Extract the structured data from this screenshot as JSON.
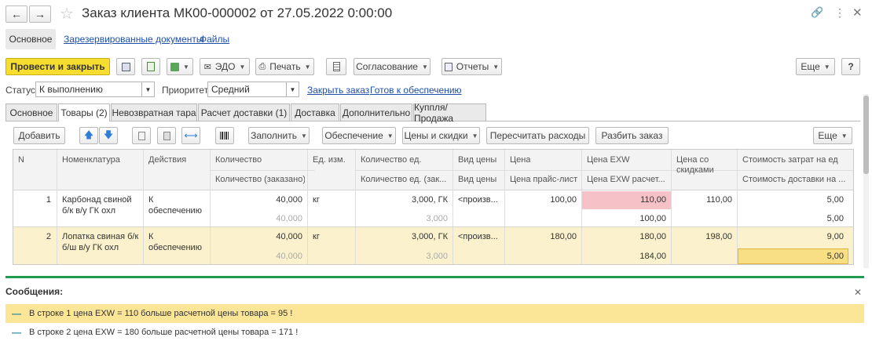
{
  "window": {
    "title": "Заказ клиента МК00-000002 от 27.05.2022 0:00:00"
  },
  "topnav": {
    "main": "Основное",
    "reserved_docs": "Зарезервированные документы",
    "files": "Файлы"
  },
  "toolbar": {
    "post_close": "Провести и закрыть",
    "edo": "ЭДО",
    "print": "Печать",
    "approval": "Согласование",
    "reports": "Отчеты",
    "more": "Еще",
    "help": "?"
  },
  "status_row": {
    "status_label": "Статус:",
    "status_value": "К выполнению",
    "priority_label": "Приоритет:",
    "priority_value": "Средний",
    "close_order": "Закрыть заказ",
    "ready_supply": "Готов к обеспечению"
  },
  "tabs": [
    {
      "label": "Основное"
    },
    {
      "label": "Товары (2)"
    },
    {
      "label": "Невозвратная тара"
    },
    {
      "label": "Расчет доставки (1)"
    },
    {
      "label": "Доставка"
    },
    {
      "label": "Дополнительно"
    },
    {
      "label": "Куппля/Продажа"
    }
  ],
  "grid_toolbar": {
    "add": "Добавить",
    "fill": "Заполнить",
    "supply": "Обеспечение",
    "prices_discounts": "Цены и скидки",
    "recalc": "Пересчитать расходы",
    "split": "Разбить заказ",
    "more": "Еще"
  },
  "grid": {
    "headers": {
      "n": "N",
      "nomenclature": "Номенклатура",
      "actions": "Действия",
      "qty": "Количество",
      "qty_ordered": "Количество (заказано)",
      "unit": "Ед. изм.",
      "qty_units": "Количество ед.",
      "qty_units_ordered": "Количество ед. (зак...",
      "price_type": "Вид цены",
      "price_type2": "Вид цены",
      "price": "Цена",
      "price_list": "Цена прайс-лист",
      "price_exw": "Цена EXW",
      "price_exw_calc": "Цена EXW расчет...",
      "price_disc_1": "Цена со",
      "price_disc_2": "скидками",
      "cost_per_unit": "Стоимость затрат на ед",
      "delivery_cost": "Стоимость доставки на ..."
    },
    "rows": [
      {
        "n": "1",
        "name_1": "Карбонад свиной",
        "name_2": "б/к в/у ГК охл",
        "action_1": "К",
        "action_2": "обеспечению",
        "qty": "40,000",
        "qty_ordered": "40,000",
        "unit": "кг",
        "qty_units": "3,000, ГК",
        "qty_units_ordered": "3,000",
        "price_type": "<произв...",
        "price": "100,00",
        "price_exw": "110,00",
        "price_exw_calc": "100,00",
        "price_disc": "110,00",
        "cost_per_unit": "5,00",
        "delivery_cost": "5,00"
      },
      {
        "n": "2",
        "name_1": "Лопатка свиная б/к",
        "name_2": "б/ш в/у ГК охл",
        "action_1": "К",
        "action_2": "обеспечению",
        "qty": "40,000",
        "qty_ordered": "40,000",
        "unit": "кг",
        "qty_units": "3,000, ГК",
        "qty_units_ordered": "3,000",
        "price_type": "<произв...",
        "price": "180,00",
        "price_exw": "180,00",
        "price_exw_calc": "184,00",
        "price_disc": "198,00",
        "cost_per_unit": "9,00",
        "delivery_cost": "5,00"
      }
    ]
  },
  "messages": {
    "title": "Сообщения:",
    "items": [
      {
        "text": "В строке 1 цена EXW = 110 больше расчетной цены товара = 95  !"
      },
      {
        "text": "В строке 2 цена EXW = 180 больше расчетной цены товара = 171  !"
      }
    ]
  },
  "colors": {
    "accent_yellow": "#f6dd2f",
    "row_highlight": "#fbf1cc",
    "error_cell": "#f7c1c8",
    "message_bar_green": "#1e9d4f"
  }
}
